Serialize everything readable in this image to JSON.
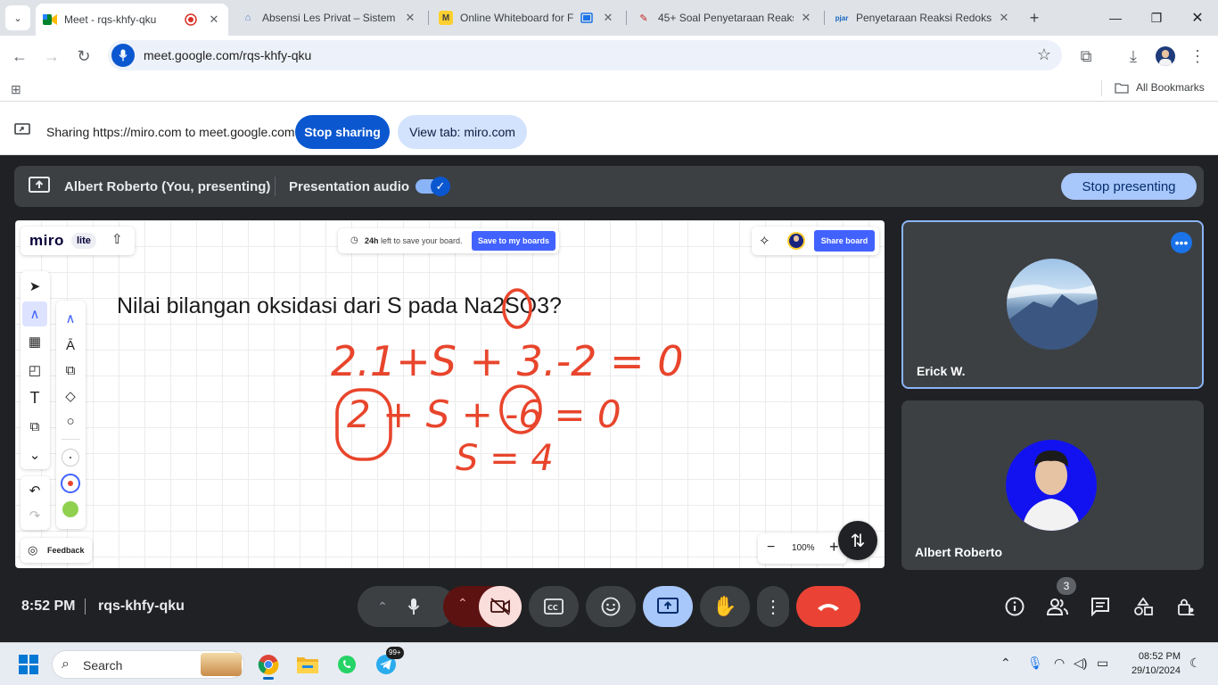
{
  "browser": {
    "tabs": [
      {
        "title": "Meet - rqs-khfy-qku",
        "active": true
      },
      {
        "title": "Absensi Les Privat – Sistem F",
        "active": false
      },
      {
        "title": "Online Whiteboard for F",
        "active": false
      },
      {
        "title": "45+ Soal Penyetaraan Reaks",
        "active": false
      },
      {
        "title": "Penyetaraan Reaksi Redoks I",
        "active": false
      }
    ],
    "new_tab_symbol": "+",
    "url": "meet.google.com/rqs-khfy-qku",
    "all_bookmarks": "All Bookmarks"
  },
  "sharebar": {
    "message": "Sharing https://miro.com to meet.google.com",
    "stop_sharing": "Stop sharing",
    "view_tab": "View tab: miro.com"
  },
  "presenting": {
    "label": "Albert Roberto (You, presenting)",
    "audio_label": "Presentation audio",
    "audio_on": true,
    "stop_presenting": "Stop presenting"
  },
  "miro": {
    "logo": "miro",
    "badge": "lite",
    "save_hours": "24h",
    "save_text": "left to save your board.",
    "save_button": "Save to my boards",
    "share_board": "Share board",
    "feedback": "Feedback",
    "zoom": "100%",
    "zoom_minus": "−",
    "zoom_plus": "+",
    "question": "Nilai bilangan oksidasi dari S pada Na2SO3?",
    "handwriting": [
      "2.1+S + 3.-2 = 0",
      "2 + S + -6 = 0",
      "S = 4"
    ],
    "ink_color": "#e8452c"
  },
  "participants": [
    {
      "name": "Erick W."
    },
    {
      "name": "Albert Roberto"
    }
  ],
  "meeting": {
    "time": "8:52 PM",
    "code": "rqs-khfy-qku",
    "people_count": "3",
    "end_call_color": "#ea4335"
  },
  "taskbar": {
    "search": "Search",
    "telegram_badge": "99+",
    "clock_time": "08:52 PM",
    "clock_date": "29/10/2024"
  }
}
